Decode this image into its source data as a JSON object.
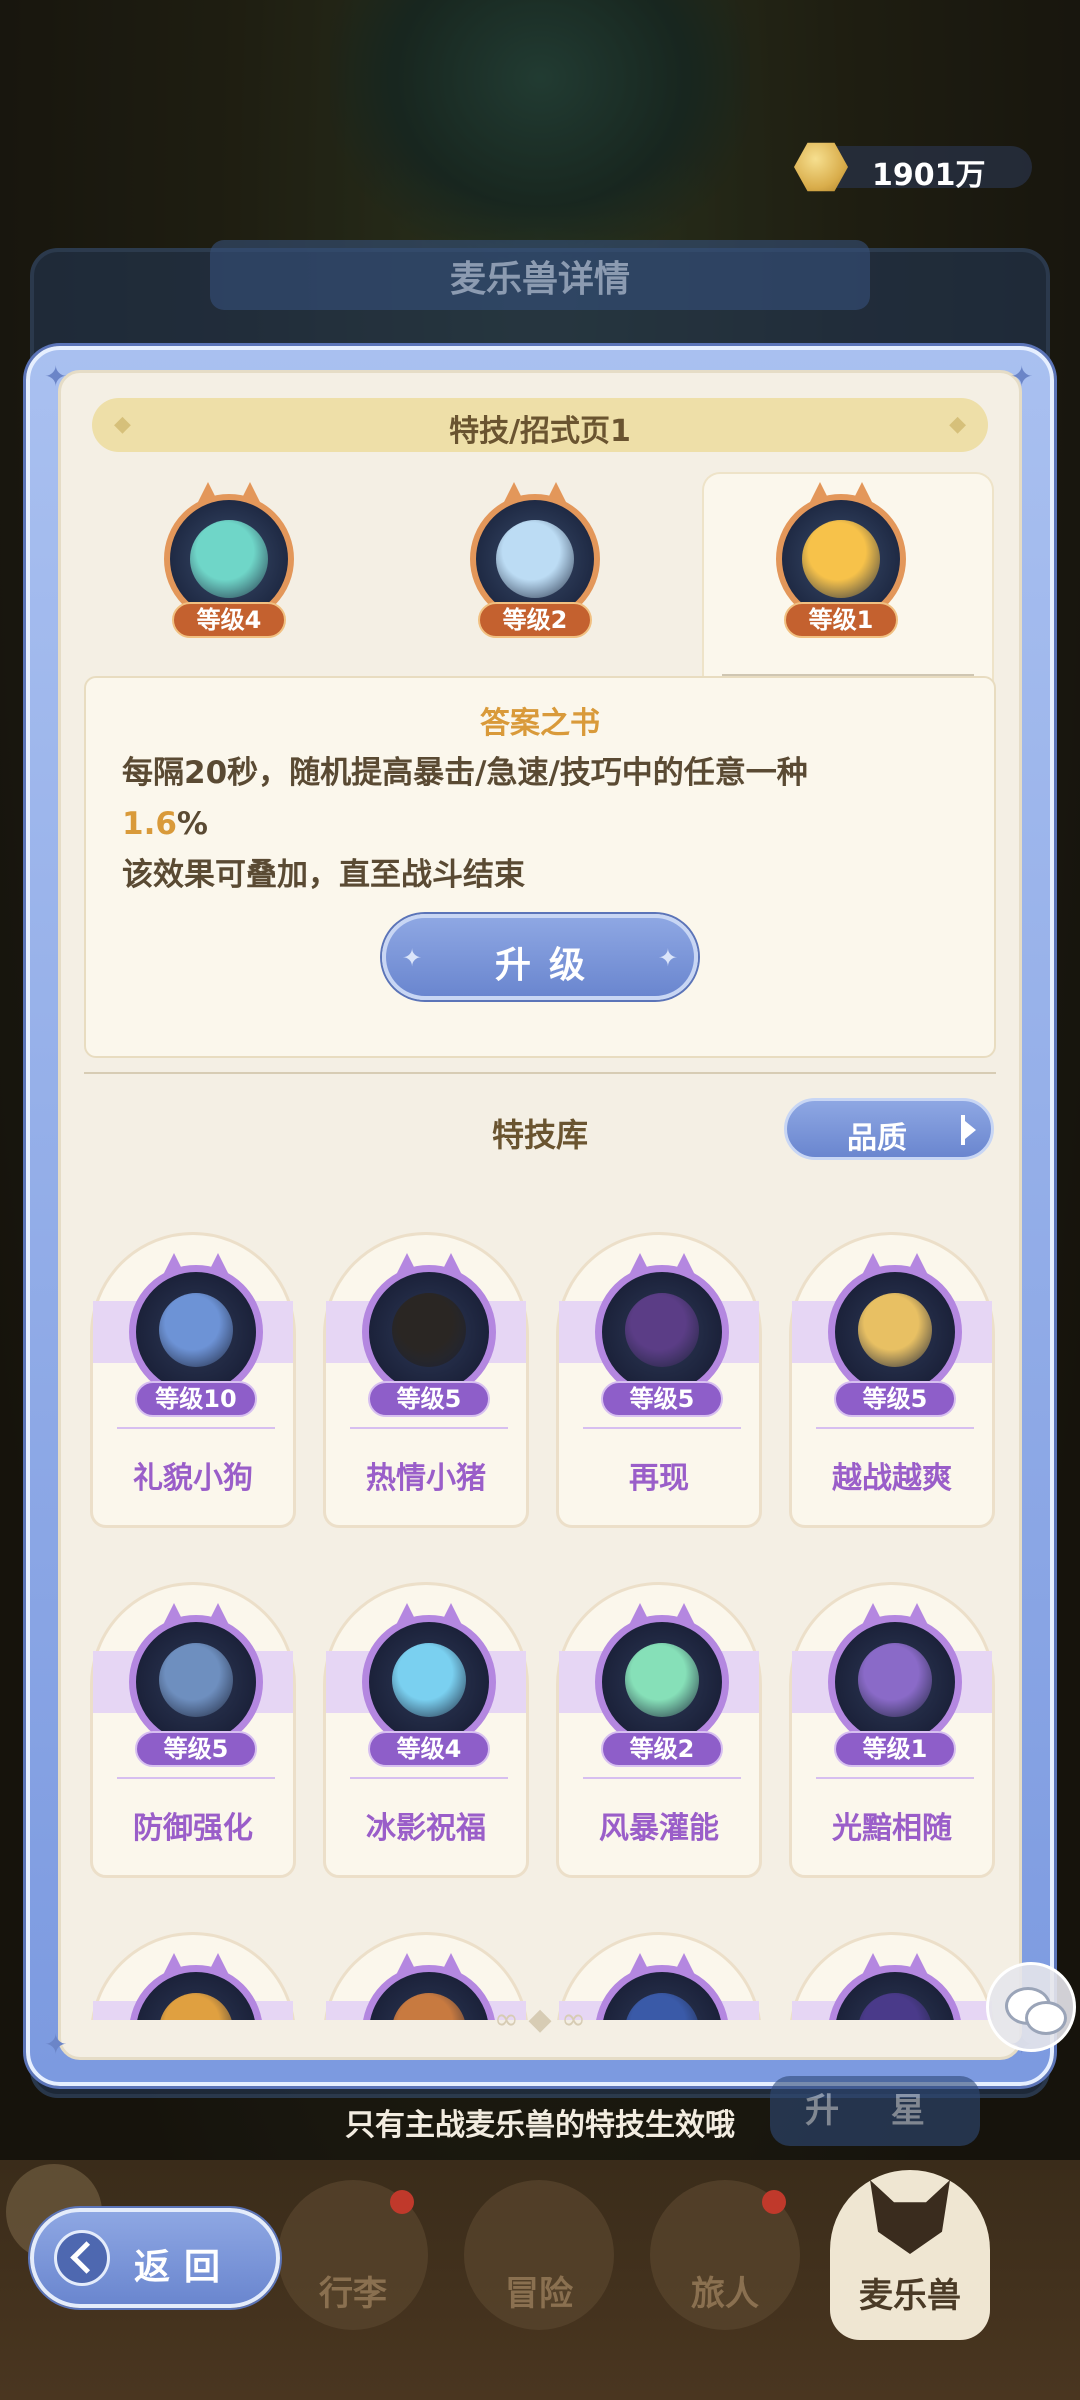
{
  "currency": {
    "amount": "1901万",
    "icon": "coin-icon"
  },
  "background_window": {
    "title": "麦乐兽详情",
    "star_button": "升 星"
  },
  "dialog": {
    "banner": "特技/招式页1",
    "slots": [
      {
        "level": "等级4",
        "color": "#6fd6c8"
      },
      {
        "level": "等级2",
        "color": "#bcdcf4"
      },
      {
        "level": "等级1",
        "color": "#f7c24a"
      }
    ],
    "skill": {
      "name": "答案之书",
      "line1": "每隔20秒，随机提高暴击/急速/技巧中的任意一种",
      "value": "1.6",
      "unit": "%",
      "line3": "该效果可叠加，直至战斗结束"
    },
    "upgrade_button": "升级",
    "library_title": "特技库",
    "quality_button": "品质",
    "skills": [
      {
        "level": "等级10",
        "name": "礼貌小狗",
        "color": "#6d93d6"
      },
      {
        "level": "等级5",
        "name": "热情小猪",
        "color": "#2a2623"
      },
      {
        "level": "等级5",
        "name": "再现",
        "color": "#5b3d86"
      },
      {
        "level": "等级5",
        "name": "越战越爽",
        "color": "#e8c063"
      },
      {
        "level": "等级5",
        "name": "防御强化",
        "color": "#6e8fbf"
      },
      {
        "level": "等级4",
        "name": "冰影祝福",
        "color": "#7ad0f0"
      },
      {
        "level": "等级2",
        "name": "风暴灌能",
        "color": "#86e0b8"
      },
      {
        "level": "等级1",
        "name": "光黯相随",
        "color": "#8a6ac8"
      },
      {
        "level": "",
        "name": "",
        "color": "#e0a040"
      },
      {
        "level": "",
        "name": "",
        "color": "#c87a40"
      },
      {
        "level": "",
        "name": "",
        "color": "#3a5aa8"
      },
      {
        "level": "",
        "name": "",
        "color": "#4a3a8a"
      }
    ]
  },
  "hint": "只有主战麦乐兽的特技生效哦",
  "nav": {
    "back": "返回",
    "items": [
      "行李",
      "冒险",
      "旅人",
      "麦乐兽"
    ],
    "active": "麦乐兽"
  }
}
